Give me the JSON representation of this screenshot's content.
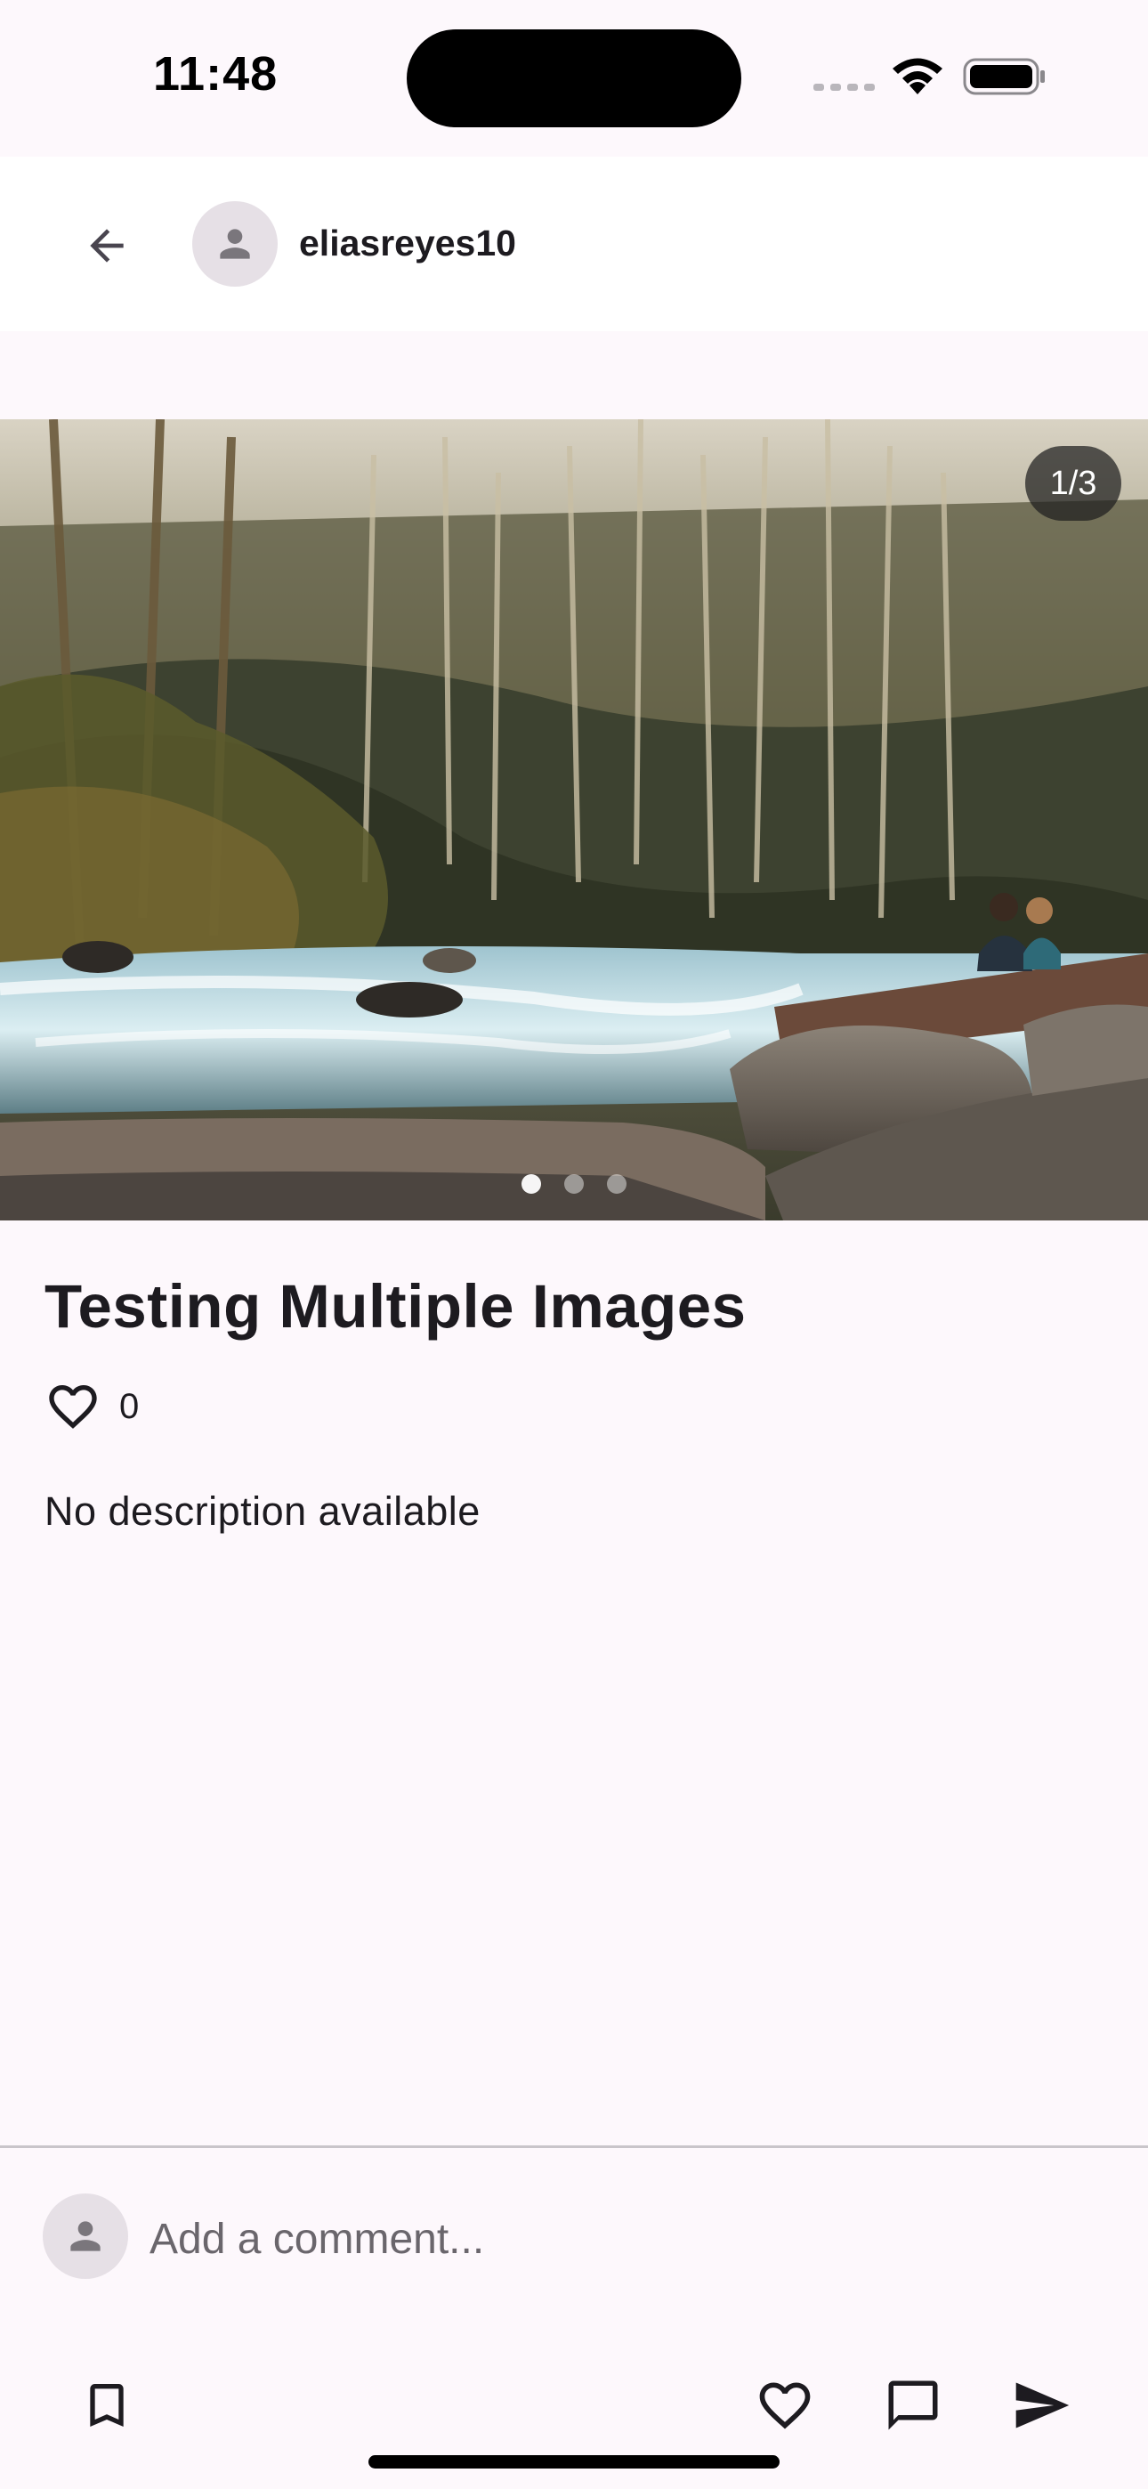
{
  "status_bar": {
    "time": "11:48"
  },
  "header": {
    "back_icon": "arrow-back-icon",
    "avatar_icon": "person-icon",
    "username": "eliasreyes10"
  },
  "carousel": {
    "image_description_icon": "river-forest-photo",
    "counter": "1/3",
    "page_count": 3,
    "current_page": 1
  },
  "post": {
    "title": "Testing Multiple Images",
    "like_icon": "heart-outline-icon",
    "like_count": "0",
    "description": "No description available"
  },
  "comment_bar": {
    "avatar_icon": "person-icon",
    "placeholder": "Add a comment..."
  },
  "actions": {
    "bookmark_icon": "bookmark-outline-icon",
    "like_icon": "heart-outline-icon",
    "comment_icon": "chat-bubble-outline-icon",
    "send_icon": "send-icon"
  },
  "colors": {
    "background": "#fdf8fc",
    "app_bar": "#ffffff",
    "text": "#1d1b20",
    "avatar_bg": "#e6e0e6",
    "avatar_fg": "#7a767c"
  }
}
